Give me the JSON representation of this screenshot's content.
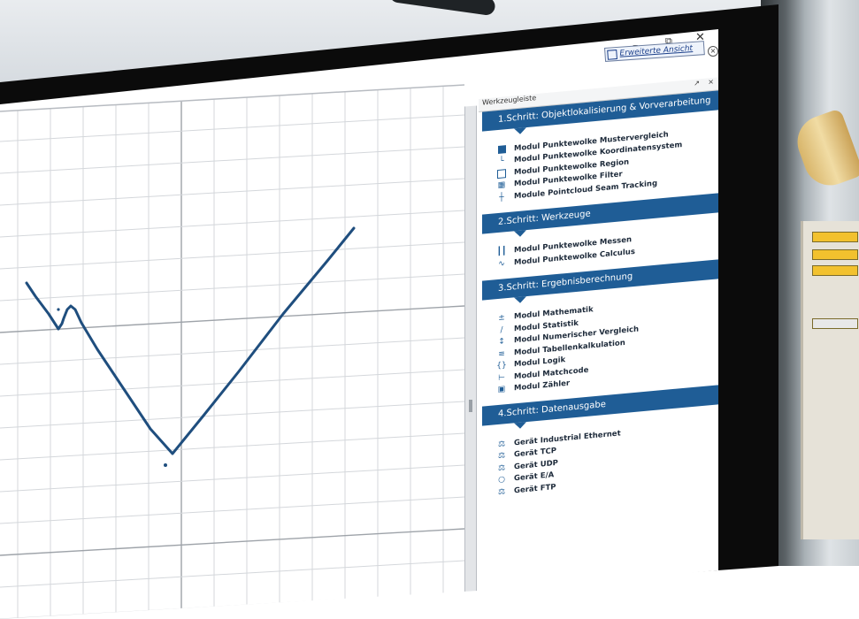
{
  "window": {
    "minimize_glyph": "–",
    "restore_glyph": "⧉",
    "close_glyph": "✕",
    "extended_view_label": "Erweiterte Ansicht",
    "extended_view_close": "×"
  },
  "toolbox": {
    "title": "Werkzeugleiste",
    "pin_glyph": "↗",
    "close_glyph": "×",
    "sections": [
      {
        "title": "1.Schritt: Objektlokalisierung & Vorverarbeitung",
        "items": [
          {
            "label": "Modul Punktewolke Mustervergleich",
            "icon": "pattern-match-icon"
          },
          {
            "label": "Modul Punktewolke Koordinatensystem",
            "icon": "coordinate-system-icon"
          },
          {
            "label": "Modul Punktewolke Region",
            "icon": "region-icon"
          },
          {
            "label": "Modul Punktewolke Filter",
            "icon": "filter-icon"
          },
          {
            "label": "Module Pointcloud Seam Tracking",
            "icon": "seam-tracking-icon"
          }
        ]
      },
      {
        "title": "2.Schritt: Werkzeuge",
        "items": [
          {
            "label": "Modul Punktewolke Messen",
            "icon": "measure-icon"
          },
          {
            "label": "Modul Punktewolke Calculus",
            "icon": "calculus-icon"
          }
        ]
      },
      {
        "title": "3.Schritt: Ergebnisberechnung",
        "items": [
          {
            "label": "Modul Mathematik",
            "icon": "math-icon"
          },
          {
            "label": "Modul Statistik",
            "icon": "statistics-icon"
          },
          {
            "label": "Modul Numerischer Vergleich",
            "icon": "numeric-compare-icon"
          },
          {
            "label": "Modul Tabellenkalkulation",
            "icon": "spreadsheet-icon"
          },
          {
            "label": "Modul Logik",
            "icon": "logic-icon"
          },
          {
            "label": "Modul Matchcode",
            "icon": "matchcode-icon"
          },
          {
            "label": "Modul Zähler",
            "icon": "counter-icon"
          }
        ]
      },
      {
        "title": "4.Schritt: Datenausgabe",
        "items": [
          {
            "label": "Gerät Industrial Ethernet",
            "icon": "ethernet-device-icon"
          },
          {
            "label": "Gerät TCP",
            "icon": "tcp-device-icon"
          },
          {
            "label": "Gerät UDP",
            "icon": "udp-device-icon"
          },
          {
            "label": "Gerät E/A",
            "icon": "io-device-icon"
          },
          {
            "label": "Gerät FTP",
            "icon": "ftp-device-icon"
          }
        ]
      }
    ]
  },
  "plot": {
    "line_color": "#1f4e7e",
    "grid_color": "#d4d7db"
  }
}
